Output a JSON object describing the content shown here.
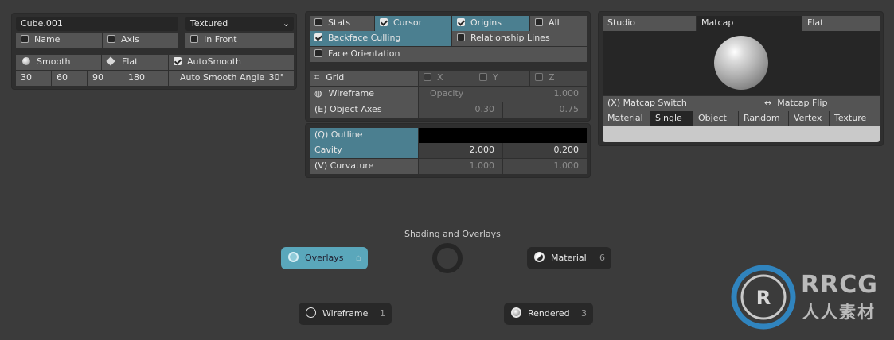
{
  "panel_object": {
    "object_name": "Cube.001",
    "display_mode": "Textured",
    "name_label": "Name",
    "axis_label": "Axis",
    "in_front_label": "In Front",
    "smooth_label": "Smooth",
    "flat_label": "Flat",
    "autosmooth_label": "AutoSmooth",
    "angles": [
      "30",
      "60",
      "90",
      "180"
    ],
    "auto_smooth_angle_label": "Auto Smooth Angle",
    "auto_smooth_angle_value": "30°"
  },
  "panel_overlays": {
    "stats": "Stats",
    "cursor": "Cursor",
    "origins": "Origins",
    "all": "All",
    "backface": "Backface Culling",
    "relationship": "Relationship Lines",
    "face_orientation": "Face Orientation",
    "grid": "Grid",
    "x": "X",
    "y": "Y",
    "z": "Z",
    "wireframe": "Wireframe",
    "opacity_label": "Opacity",
    "opacity_value": "1.000",
    "object_axes": "(E) Object Axes",
    "axes_a": "0.30",
    "axes_b": "0.75"
  },
  "panel_outline": {
    "outline": "(Q) Outline",
    "cavity": "Cavity",
    "cavity_a": "2.000",
    "cavity_b": "0.200",
    "curvature": "(V) Curvature",
    "curv_a": "1.000",
    "curv_b": "1.000"
  },
  "panel_lighting": {
    "tabs": [
      "Studio",
      "Matcap",
      "Flat"
    ],
    "matcap_switch": "(X) Matcap Switch",
    "matcap_flip": "Matcap Flip",
    "color_tabs": [
      "Material",
      "Single",
      "Object",
      "Random",
      "Vertex",
      "Texture"
    ]
  },
  "pie": {
    "title": "Shading and Overlays",
    "overlays": "Overlays",
    "material": "Material",
    "material_num": "6",
    "wireframe": "Wireframe",
    "wireframe_num": "1",
    "rendered": "Rendered",
    "rendered_num": "3"
  },
  "watermark": {
    "title": "RRCG",
    "subtitle": "人人素材"
  },
  "colors": {
    "accent": "#4b7f90",
    "pie_active": "#5aa7bb",
    "bg": "#3b3b3b"
  }
}
